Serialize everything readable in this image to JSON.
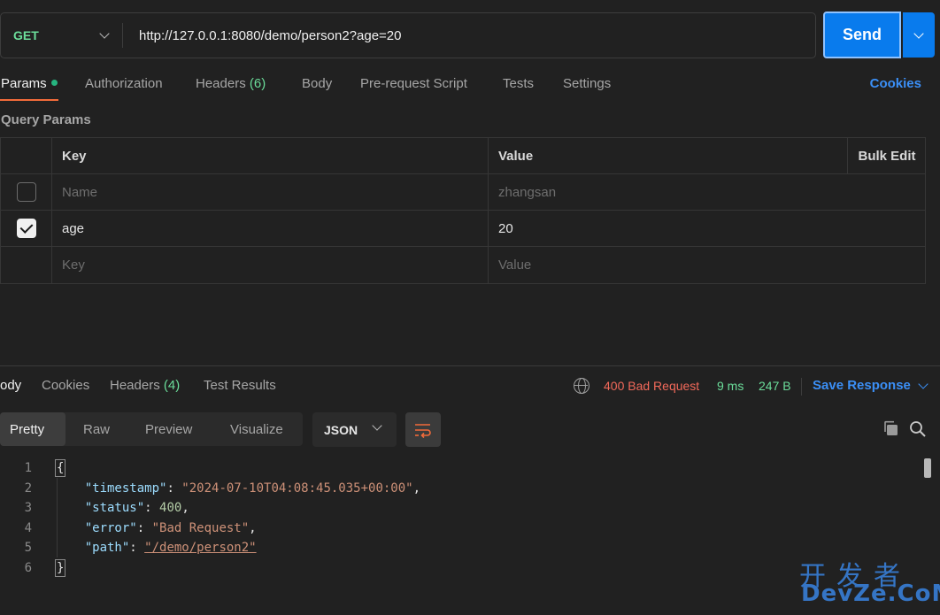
{
  "request": {
    "method": "GET",
    "url": "http://127.0.0.1:8080/demo/person2?age=20",
    "send_label": "Send"
  },
  "request_tabs": {
    "params": "Params",
    "authorization": "Authorization",
    "headers": "Headers",
    "headers_count": "(6)",
    "body": "Body",
    "pre_request": "Pre-request Script",
    "tests": "Tests",
    "settings": "Settings",
    "cookies": "Cookies"
  },
  "query_params": {
    "section_title": "Query Params",
    "headers": {
      "key": "Key",
      "value": "Value",
      "bulk_edit": "Bulk Edit"
    },
    "rows": [
      {
        "checked": false,
        "key": "Name",
        "value": "zhangsan",
        "disabled": true
      },
      {
        "checked": true,
        "key": "age",
        "value": "20",
        "disabled": false
      },
      {
        "checked": false,
        "key": "Key",
        "value": "Value",
        "placeholder": true
      }
    ]
  },
  "response_tabs": {
    "body": "ody",
    "cookies": "Cookies",
    "headers": "Headers",
    "headers_count": "(4)",
    "test_results": "Test Results"
  },
  "response_meta": {
    "status": "400 Bad Request",
    "time": "9 ms",
    "size": "247 B",
    "save_response": "Save Response"
  },
  "view": {
    "modes": [
      "Pretty",
      "Raw",
      "Preview",
      "Visualize"
    ],
    "active": "Pretty",
    "format": "JSON"
  },
  "response_body": {
    "line_numbers": [
      "1",
      "2",
      "3",
      "4",
      "5",
      "6"
    ],
    "open_brace": "{",
    "close_brace": "}",
    "fields": [
      {
        "key": "\"timestamp\"",
        "value": "\"2024-07-10T04:08:45.035+00:00\"",
        "type": "string",
        "comma": ","
      },
      {
        "key": "\"status\"",
        "value": "400",
        "type": "number",
        "comma": ","
      },
      {
        "key": "\"error\"",
        "value": "\"Bad Request\"",
        "type": "string",
        "comma": ","
      },
      {
        "key": "\"path\"",
        "value": "\"/demo/person2\"",
        "type": "link",
        "comma": ""
      }
    ]
  },
  "watermark": {
    "cn": "开发者",
    "en": "DevZe.CoM"
  },
  "colors": {
    "background": "#212121",
    "send_button": "#097bed",
    "method_get": "#6bdd9a",
    "status_error": "#f2695a",
    "link_blue": "#3b8ff6",
    "active_tab_underline": "#f26b3a"
  }
}
